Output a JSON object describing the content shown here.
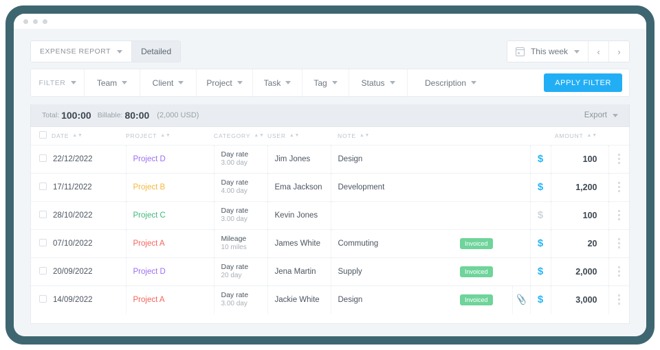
{
  "window": {
    "dots": 3
  },
  "toolbar": {
    "report_label": "EXPENSE REPORT",
    "detailed_label": "Detailed",
    "date_range_label": "This week",
    "prev_label": "‹",
    "next_label": "›"
  },
  "filter_bar": {
    "items": [
      {
        "label": "FILTER"
      },
      {
        "label": "Team"
      },
      {
        "label": "Client"
      },
      {
        "label": "Project"
      },
      {
        "label": "Task"
      },
      {
        "label": "Tag"
      },
      {
        "label": "Status"
      },
      {
        "label": "Description"
      }
    ],
    "apply_label": "APPLY FILTER",
    "accent_color": "#22aef5"
  },
  "totals": {
    "total_label": "Total:",
    "total_value": "100:00",
    "billable_label": "Billable:",
    "billable_value": "80:00",
    "currency_note": "(2,000 USD)",
    "export_label": "Export"
  },
  "table": {
    "columns": [
      {
        "key": "date",
        "label": "DATE"
      },
      {
        "key": "project",
        "label": "PROJECT"
      },
      {
        "key": "category",
        "label": "CATEGORY"
      },
      {
        "key": "user",
        "label": "USER"
      },
      {
        "key": "note",
        "label": "NOTE"
      },
      {
        "key": "amount",
        "label": "AMOUNT"
      }
    ],
    "rows": [
      {
        "date": "22/12/2022",
        "project": "Project D",
        "project_color": "#9b6ef3",
        "category": "Day rate",
        "quantity": "3.00 day",
        "user": "Jim Jones",
        "note": "Design",
        "badge": "",
        "attachment": false,
        "billable": true,
        "amount": "100"
      },
      {
        "date": "17/11/2022",
        "project": "Project B",
        "project_color": "#f5b73d",
        "category": "Day rate",
        "quantity": "4.00 day",
        "user": "Ema Jackson",
        "note": "Development",
        "badge": "",
        "attachment": false,
        "billable": true,
        "amount": "1,200"
      },
      {
        "date": "28/10/2022",
        "project": "Project C",
        "project_color": "#3cb878",
        "category": "Day rate",
        "quantity": "3.00 day",
        "user": "Kevin Jones",
        "note": "",
        "badge": "",
        "attachment": false,
        "billable": false,
        "amount": "100"
      },
      {
        "date": "07/10/2022",
        "project": "Project A",
        "project_color": "#f4635b",
        "category": "Mileage",
        "quantity": "10 miles",
        "user": "James White",
        "note": "Commuting",
        "badge": "Invoiced",
        "attachment": false,
        "billable": true,
        "amount": "20"
      },
      {
        "date": "20/09/2022",
        "project": "Project D",
        "project_color": "#9b6ef3",
        "category": "Day rate",
        "quantity": "20 day",
        "user": "Jena Martin",
        "note": "Supply",
        "badge": "Invoiced",
        "attachment": false,
        "billable": true,
        "amount": "2,000"
      },
      {
        "date": "14/09/2022",
        "project": "Project A",
        "project_color": "#f4635b",
        "category": "Day rate",
        "quantity": "3.00 day",
        "user": "Jackie White",
        "note": "Design",
        "badge": "Invoiced",
        "attachment": true,
        "billable": true,
        "amount": "3,000"
      }
    ],
    "currency_symbol": "$",
    "attachment_glyph": "📎",
    "badge_color": "#6ed49a"
  }
}
